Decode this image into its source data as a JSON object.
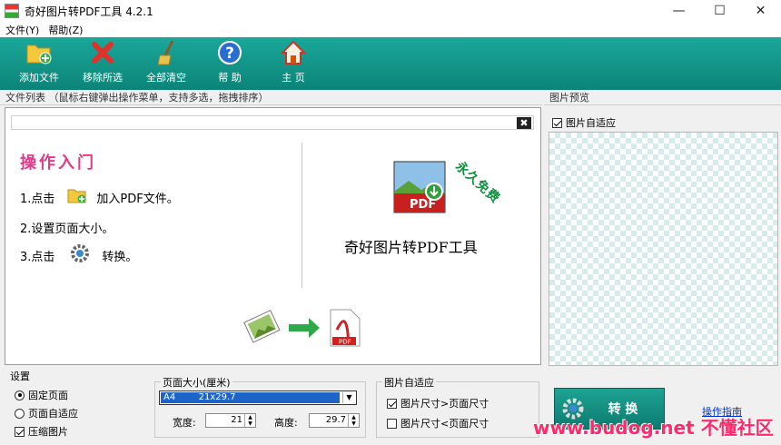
{
  "window": {
    "title": "奇好图片转PDF工具 4.2.1",
    "minimize": "—",
    "maximize": "☐",
    "close": "✕"
  },
  "menu": [
    "文件(Y)",
    "帮助(Z)"
  ],
  "toolbar": {
    "add": "添加文件",
    "remove": "移除所选",
    "clear": "全部清空",
    "help": "帮 助",
    "home": "主 页"
  },
  "file_list": {
    "header": "文件列表  （鼠标右键弹出操作菜单，支持多选，拖拽排序）",
    "close_glyph": "✖",
    "intro_title": "操作入门",
    "step1_a": "1.点击",
    "step1_b": "加入PDF文件。",
    "step2": "2.设置页面大小。",
    "step3_a": "3.点击",
    "step3_b": "转换。",
    "product_name": "奇好图片转PDF工具",
    "stamp": "永久免费"
  },
  "preview": {
    "header": "图片预览",
    "autofit_label": "图片自适应",
    "autofit_checked": true
  },
  "settings": {
    "group_label": "设置",
    "fixed_page": "固定页面",
    "auto_page": "页面自适应",
    "compress": "压缩图片",
    "fixed_selected": true,
    "compress_checked": true
  },
  "page_size": {
    "group_label": "页面大小(厘米)",
    "selected": "A4        21x29.7",
    "width_label": "宽度:",
    "width_value": "21",
    "height_label": "高度:",
    "height_value": "29.7"
  },
  "image_fit": {
    "group_label": "图片自适应",
    "opt1": "图片尺寸>页面尺寸",
    "opt2": "图片尺寸<页面尺寸",
    "opt1_checked": true,
    "opt2_checked": false
  },
  "actions": {
    "convert": "转 换",
    "guide": "操作指南"
  },
  "watermark": "www.budog.net 不懂社区"
}
